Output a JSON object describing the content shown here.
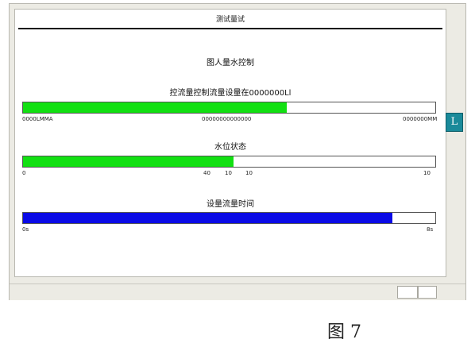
{
  "window": {
    "title": "测试量试"
  },
  "panel": {
    "heading": "图人量水控制"
  },
  "gauges": [
    {
      "label": "控流量控制流量设量在0000000Ll",
      "value_fraction": 0.64,
      "color": "#12e012",
      "tick_labels": [
        "0000LMMA",
        "00000000000000",
        "0000000MM"
      ]
    },
    {
      "label": "水位状态",
      "value_fraction": 0.51,
      "color": "#12e012",
      "tick_labels": [
        "0",
        "40",
        "10",
        "10",
        "10"
      ]
    },
    {
      "label": "设量流量时间",
      "value_fraction": 0.896,
      "color": "#0a0ae6",
      "tick_labels": [
        "0s",
        "8s"
      ]
    }
  ],
  "side_button": {
    "glyph": "L"
  },
  "caption": "图 7"
}
